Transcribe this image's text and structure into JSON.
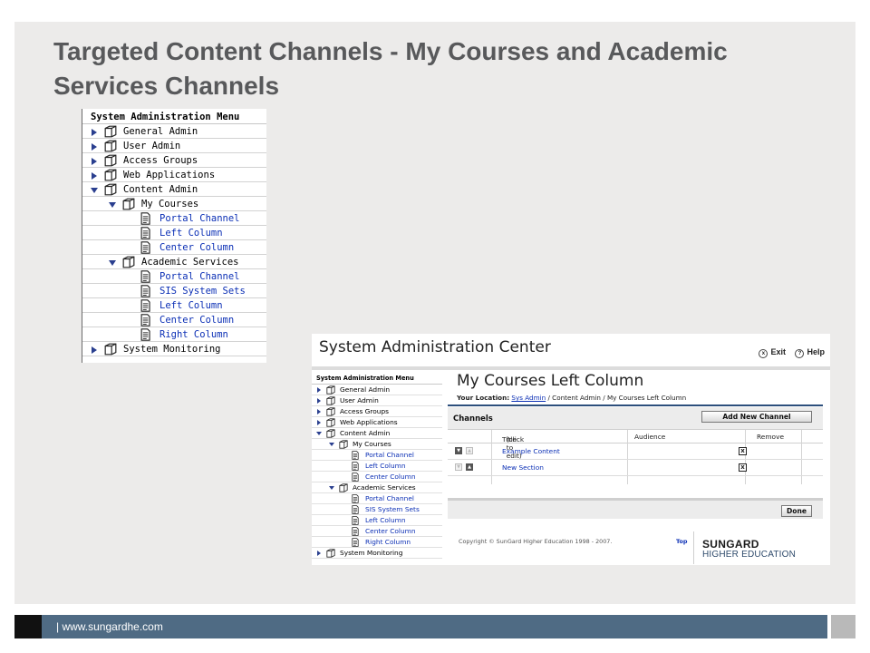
{
  "slide": {
    "title": "Targeted Content Channels - My Courses and Academic Services Channels",
    "footer": "| www.sungardhe.com"
  },
  "menu": {
    "header": "System Administration Menu",
    "items": [
      {
        "label": "General Admin",
        "kind": "folder",
        "level": 0,
        "expanded": false,
        "link": false
      },
      {
        "label": "User Admin",
        "kind": "folder",
        "level": 0,
        "expanded": false,
        "link": false
      },
      {
        "label": "Access Groups",
        "kind": "folder",
        "level": 0,
        "expanded": false,
        "link": false
      },
      {
        "label": "Web Applications",
        "kind": "folder",
        "level": 0,
        "expanded": false,
        "link": false
      },
      {
        "label": "Content Admin",
        "kind": "folder",
        "level": 0,
        "expanded": true,
        "link": false
      },
      {
        "label": "My Courses",
        "kind": "folder",
        "level": 1,
        "expanded": true,
        "link": false
      },
      {
        "label": "Portal Channel",
        "kind": "doc",
        "level": 2,
        "link": true
      },
      {
        "label": "Left Column",
        "kind": "doc",
        "level": 2,
        "link": true
      },
      {
        "label": "Center Column",
        "kind": "doc",
        "level": 2,
        "link": true
      },
      {
        "label": "Academic Services",
        "kind": "folder",
        "level": 1,
        "expanded": true,
        "link": false
      },
      {
        "label": "Portal Channel",
        "kind": "doc",
        "level": 2,
        "link": true
      },
      {
        "label": "SIS System Sets",
        "kind": "doc",
        "level": 2,
        "link": true
      },
      {
        "label": "Left Column",
        "kind": "doc",
        "level": 2,
        "link": true
      },
      {
        "label": "Center Column",
        "kind": "doc",
        "level": 2,
        "link": true
      },
      {
        "label": "Right Column",
        "kind": "doc",
        "level": 2,
        "link": true
      },
      {
        "label": "System Monitoring",
        "kind": "folder",
        "level": 0,
        "expanded": false,
        "link": false
      }
    ]
  },
  "app": {
    "title": "System Administration Center",
    "exit_label": "Exit",
    "help_label": "Help"
  },
  "pane": {
    "title": "My Courses Left Column",
    "location_label": "Your Location:",
    "location_link": "Sys Admin",
    "location_rest": "/ Content Admin / My Courses Left Column",
    "channels_label": "Channels",
    "add_button": "Add New Channel",
    "columns": {
      "title": "Title",
      "title_hint": "(click to edit)",
      "audience": "Audience",
      "remove": "Remove"
    },
    "rows": [
      {
        "title": "Example Content",
        "up_enabled": false,
        "down_enabled": true
      },
      {
        "title": "New Section",
        "up_enabled": true,
        "down_enabled": false
      }
    ],
    "done_button": "Done",
    "copyright": "Copyright © SunGard Higher Education 1998 - 2007.",
    "top_link": "Top",
    "logo_line1": "SUNGARD",
    "logo_line2": "HIGHER EDUCATION"
  }
}
